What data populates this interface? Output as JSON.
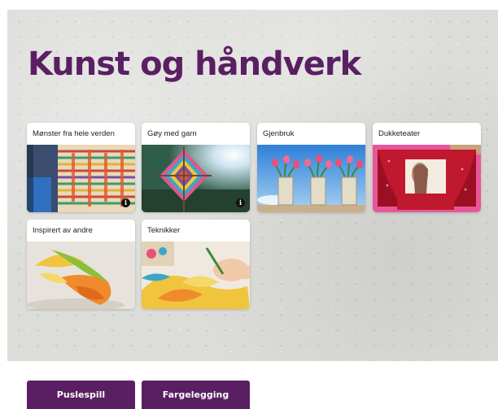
{
  "page": {
    "title": "Kunst og håndverk"
  },
  "cards": [
    {
      "label": "Mønster fra hele verden",
      "image": "woven-textile-photo",
      "info_icon": "info-icon"
    },
    {
      "label": "Gøy med garn",
      "image": "yarn-gods-eye-photo",
      "info_icon": "info-icon"
    },
    {
      "label": "Gjenbruk",
      "image": "tulips-in-tin-cans-photo"
    },
    {
      "label": "Dukketeater",
      "image": "puppet-theater-photo"
    },
    {
      "label": "Inspirert av andre",
      "image": "paper-spiral-sculpture-photo"
    },
    {
      "label": "Teknikker",
      "image": "painting-leaves-photo"
    }
  ],
  "buttons": {
    "puzzle": "Puslespill",
    "coloring": "Fargelegging"
  },
  "colors": {
    "brand_purple": "#5a1f62",
    "card_background": "#ffffff",
    "hero_background": "#dcdcd9"
  }
}
